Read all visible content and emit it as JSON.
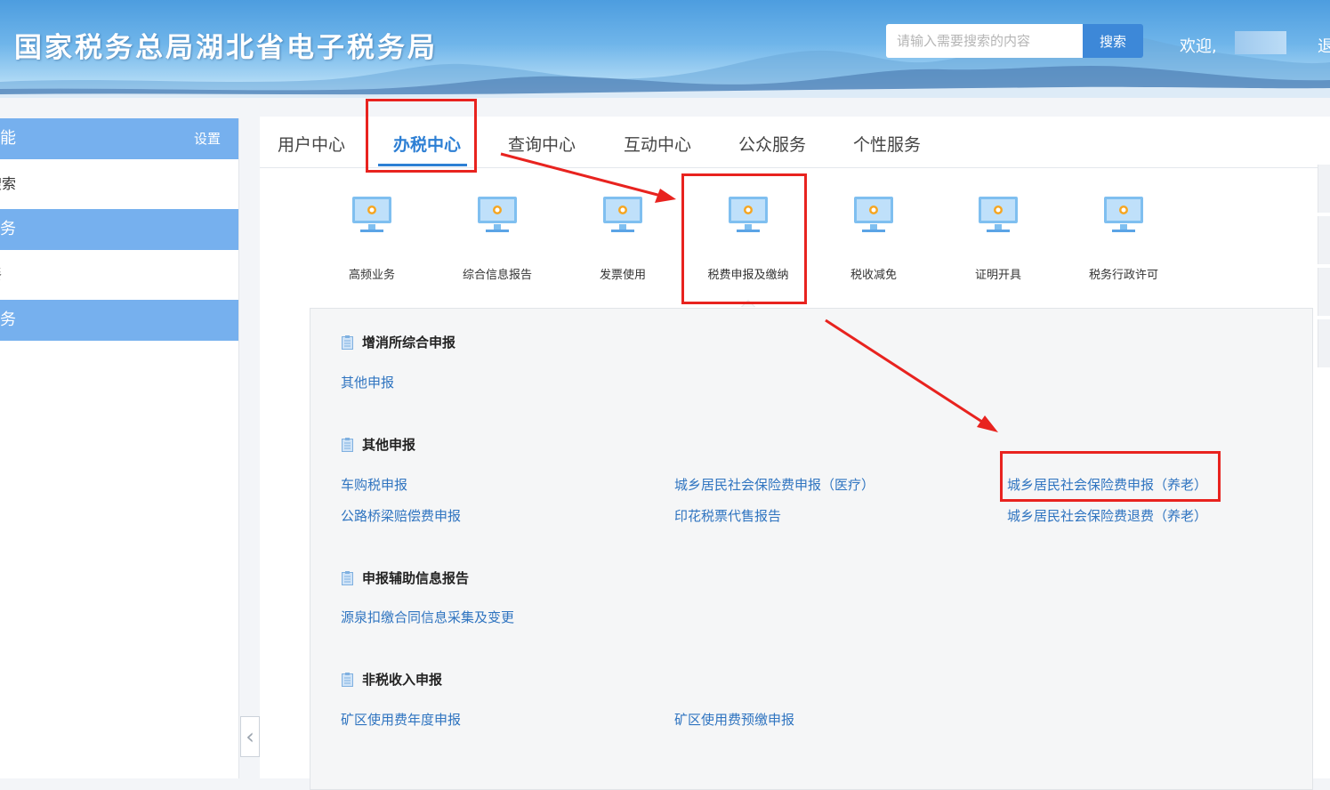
{
  "header": {
    "site_title": "国家税务总局湖北省电子税务局",
    "search_placeholder": "请输入需要搜索的内容",
    "search_button": "搜索",
    "welcome": "欢迎,",
    "logout_partial": "退"
  },
  "sidebar": {
    "head_label": "功能",
    "settings_label": "设置",
    "rows": [
      {
        "type": "item",
        "label": "搜索"
      },
      {
        "type": "section",
        "label": "业务"
      },
      {
        "type": "item",
        "label": "餐"
      },
      {
        "type": "section",
        "label": "业务"
      }
    ]
  },
  "tabs": [
    {
      "label": "用户中心",
      "active": false
    },
    {
      "label": "办税中心",
      "active": true
    },
    {
      "label": "查询中心",
      "active": false
    },
    {
      "label": "互动中心",
      "active": false
    },
    {
      "label": "公众服务",
      "active": false
    },
    {
      "label": "个性服务",
      "active": false
    }
  ],
  "service_icons": [
    {
      "label": "高频业务",
      "icon": "monitor-icon"
    },
    {
      "label": "综合信息报告",
      "icon": "monitor-icon"
    },
    {
      "label": "发票使用",
      "icon": "monitor-icon"
    },
    {
      "label": "税费申报及缴纳",
      "icon": "monitor-icon",
      "selected": true
    },
    {
      "label": "税收减免",
      "icon": "monitor-icon"
    },
    {
      "label": "证明开具",
      "icon": "monitor-icon"
    },
    {
      "label": "税务行政许可",
      "icon": "monitor-icon"
    }
  ],
  "sections": [
    {
      "title": "增消所综合申报",
      "links": [
        [
          "其他申报"
        ]
      ]
    },
    {
      "title": "其他申报",
      "links": [
        [
          "车购税申报",
          "城乡居民社会保险费申报（医疗）",
          "城乡居民社会保险费申报（养老）"
        ],
        [
          "公路桥梁赔偿费申报",
          "印花税票代售报告",
          "城乡居民社会保险费退费（养老）"
        ]
      ]
    },
    {
      "title": "申报辅助信息报告",
      "links": [
        [
          "源泉扣缴合同信息采集及变更"
        ]
      ]
    },
    {
      "title": "非税收入申报",
      "links": [
        [
          "矿区使用费年度申报",
          "矿区使用费预缴申报"
        ]
      ]
    }
  ],
  "colors": {
    "accent": "#2d7fd4",
    "sidebar_blue": "#76b0ee",
    "link": "#2f74c0",
    "annotation_red": "#e8231f"
  }
}
